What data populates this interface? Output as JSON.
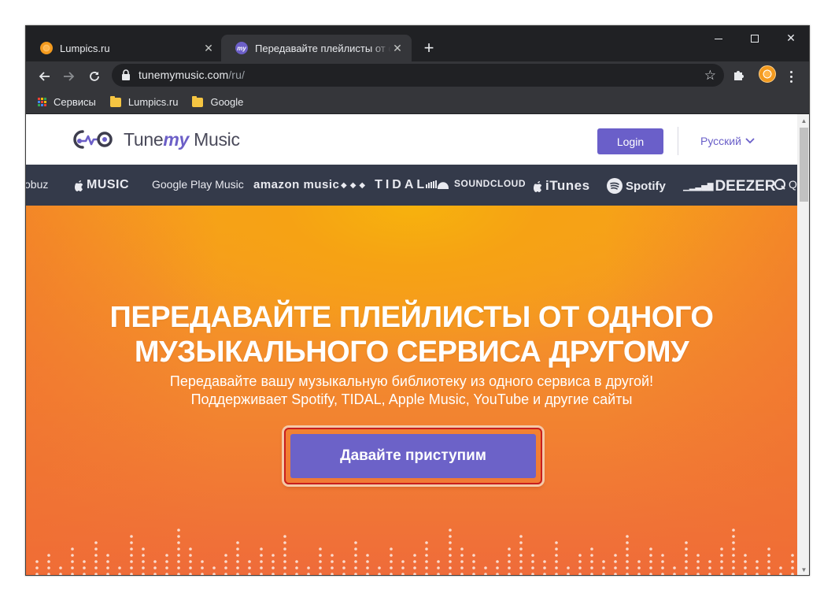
{
  "browser": {
    "tabs": [
      {
        "title": "Lumpics.ru",
        "active": false
      },
      {
        "title": "Передавайте плейлисты от одного музыкального сервиса",
        "active": true
      }
    ],
    "new_tab": "+",
    "url_host": "tunemymusic.com",
    "url_path": "/ru/",
    "bookmarks": [
      {
        "label": "Сервисы",
        "icon": "apps-grid-icon"
      },
      {
        "label": "Lumpics.ru",
        "icon": "folder-icon"
      },
      {
        "label": "Google",
        "icon": "folder-icon"
      }
    ],
    "colors": {
      "frame": "#202124",
      "toolbar": "#35363a"
    }
  },
  "site": {
    "logo": {
      "tune": "Tune",
      "my": "my",
      "music": "Music"
    },
    "login_label": "Login",
    "language": "Русский",
    "services": [
      "obuz",
      "MUSIC",
      "Google Play Music",
      "amazon music",
      "TIDAL",
      "SOUNDCLOUD",
      "iTunes",
      "Spotify",
      "DEEZER",
      "Q"
    ],
    "hero_title": "ПЕРЕДАВАЙТЕ ПЛЕЙЛИСТЫ ОТ ОДНОГО МУЗЫКАЛЬНОГО СЕРВИСА ДРУГОМУ",
    "hero_subtitle_1": "Передавайте вашу музыкальную библиотеку из одного сервиса в другой!",
    "hero_subtitle_2": "Поддерживает Spotify, TIDAL, Apple Music, YouTube и другие сайты",
    "cta_label": "Давайте приступим",
    "colors": {
      "accent": "#6a5fc9",
      "highlight": "#c81e1e",
      "hero_top": "#f7b20d",
      "hero_bottom": "#ef6b3a",
      "services_bar": "#343a4a"
    }
  }
}
